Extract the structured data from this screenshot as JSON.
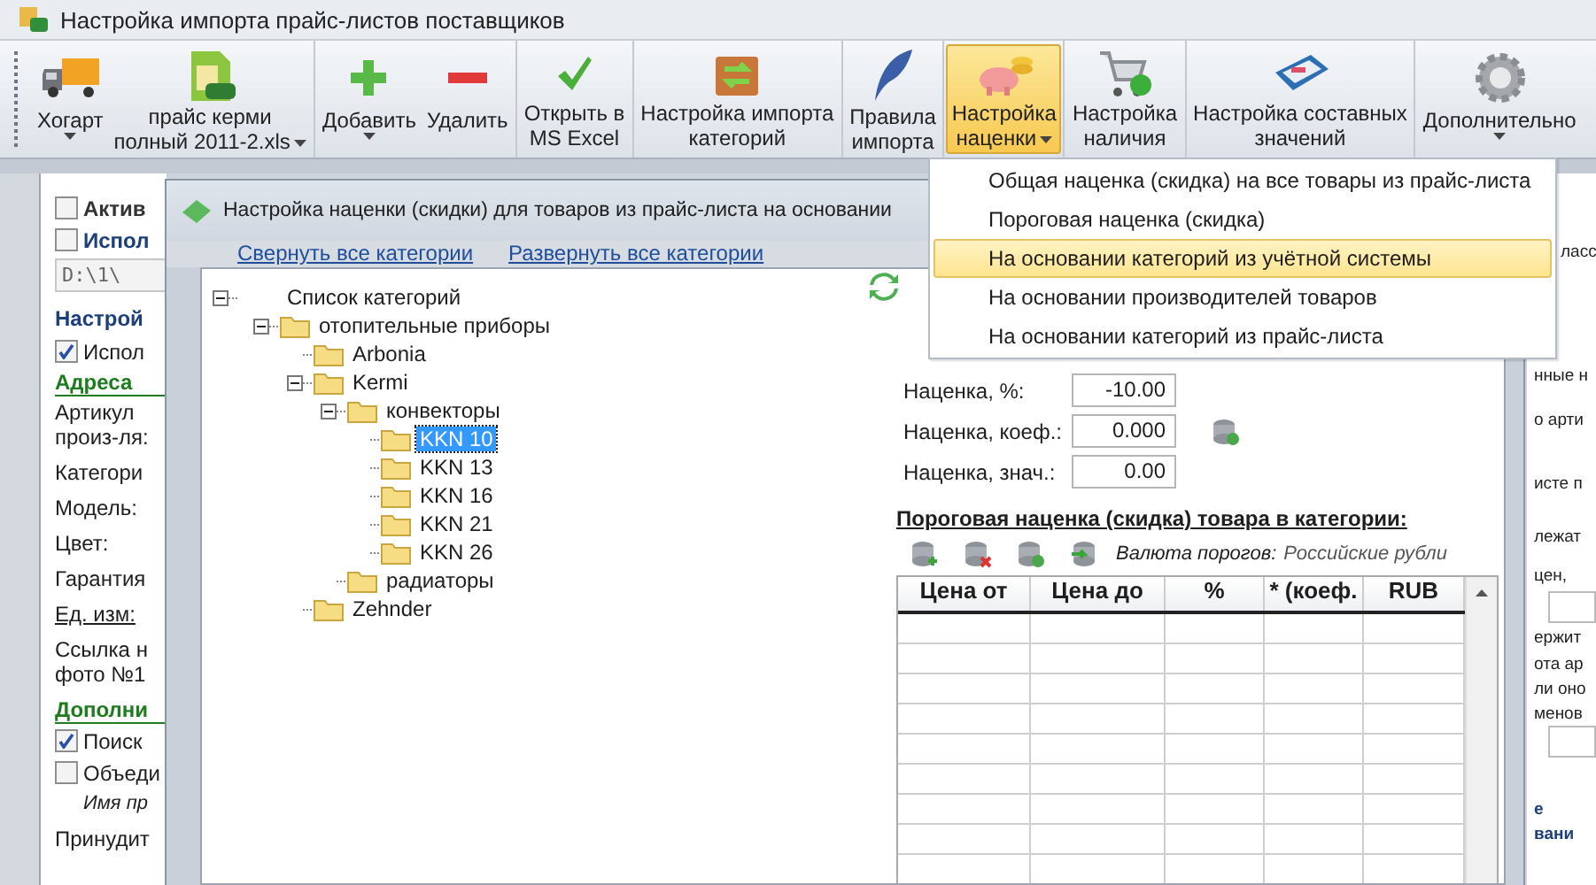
{
  "window": {
    "title": "Настройка импорта прайс-листов поставщиков"
  },
  "toolbar": {
    "groups": [
      [
        {
          "lines": [
            "Хогарт"
          ],
          "dropdown": true,
          "selected": false
        },
        {
          "lines": [
            "прайс керми",
            "полный 2011-2.xls"
          ],
          "dropdown": true,
          "selected": false
        }
      ],
      [
        {
          "lines": [
            "Добавить"
          ],
          "dropdown": true,
          "selected": false
        },
        {
          "lines": [
            "Удалить"
          ],
          "dropdown": false,
          "selected": false
        }
      ],
      [
        {
          "lines": [
            "Открыть в",
            "MS Excel"
          ],
          "dropdown": false,
          "selected": false
        }
      ],
      [
        {
          "lines": [
            "Настройка импорта",
            "категорий"
          ],
          "dropdown": false,
          "selected": false
        }
      ],
      [
        {
          "lines": [
            "Правила",
            "импорта"
          ],
          "dropdown": false,
          "selected": false
        }
      ],
      [
        {
          "lines": [
            "Настройка",
            "наценки"
          ],
          "dropdown": true,
          "selected": true
        }
      ],
      [
        {
          "lines": [
            "Настройка",
            "наличия"
          ],
          "dropdown": false,
          "selected": false
        }
      ],
      [
        {
          "lines": [
            "Настройка составных",
            "значений"
          ],
          "dropdown": false,
          "selected": false
        }
      ],
      [
        {
          "lines": [
            "Дополнительно"
          ],
          "dropdown": true,
          "selected": false
        }
      ]
    ]
  },
  "left_panel": [
    {
      "kind": "checkbox",
      "label": "Актив",
      "checked": false
    },
    {
      "kind": "checkbox-title",
      "label": "Испол",
      "checked": false
    },
    {
      "kind": "path-field",
      "value": "D:\\1\\"
    },
    {
      "kind": "group-title",
      "lines": [
        "Настрой"
      ]
    },
    {
      "kind": "checkbox",
      "label": "Испол",
      "checked": true
    },
    {
      "kind": "section",
      "lines": [
        "Адреса"
      ]
    },
    {
      "kind": "label",
      "lines": [
        "Артикул",
        "произ-ля:"
      ]
    },
    {
      "kind": "label",
      "lines": [
        "Категори"
      ]
    },
    {
      "kind": "label",
      "lines": [
        "Модель:"
      ]
    },
    {
      "kind": "label",
      "lines": [
        "Цвет:"
      ]
    },
    {
      "kind": "label",
      "lines": [
        "Гарантия"
      ]
    },
    {
      "kind": "underlined",
      "lines": [
        "Ед. изм:"
      ]
    },
    {
      "kind": "label",
      "lines": [
        "Ссылка н",
        "фото №1"
      ]
    },
    {
      "kind": "section",
      "lines": [
        "Дополни"
      ]
    },
    {
      "kind": "checkbox",
      "label": "Поиск",
      "checked": true
    },
    {
      "kind": "checkbox",
      "label": "Объеди",
      "checked": false
    },
    {
      "kind": "note",
      "lines": [
        "Имя пр"
      ]
    },
    {
      "kind": "label",
      "lines": [
        "Принудит"
      ]
    }
  ],
  "right_panel": [
    {
      "kind": "text",
      "text": "ласс"
    },
    {
      "kind": "text",
      "text": "нные н"
    },
    {
      "kind": "text",
      "text": "о арти"
    },
    {
      "kind": "text",
      "text": "исте п"
    },
    {
      "kind": "text",
      "text": "лежат"
    },
    {
      "kind": "text",
      "text": "цен,"
    },
    {
      "kind": "field"
    },
    {
      "kind": "text",
      "text": "ержит"
    },
    {
      "kind": "text",
      "text": "ота ар"
    },
    {
      "kind": "text",
      "text": "ли оно"
    },
    {
      "kind": "text",
      "text": "менов"
    },
    {
      "kind": "field"
    },
    {
      "kind": "heading",
      "text": "е"
    },
    {
      "kind": "heading",
      "text": "вани"
    }
  ],
  "dialog": {
    "title": "Настройка наценки (скидки) для товаров из прайс-листа на основании",
    "links": [
      "Свернуть все категории",
      "Развернуть все категории"
    ],
    "tree": {
      "label": "Список категорий",
      "kind": "root",
      "expanded": true,
      "selected": false,
      "children": [
        {
          "label": "отопительные приборы",
          "kind": "folder",
          "expanded": true,
          "selected": false,
          "children": [
            {
              "label": "Arbonia",
              "kind": "folder",
              "expanded": false,
              "selected": false
            },
            {
              "label": "Kermi",
              "kind": "folder",
              "expanded": true,
              "selected": false,
              "children": [
                {
                  "label": "конвекторы",
                  "kind": "folder",
                  "expanded": true,
                  "selected": false,
                  "children": [
                    {
                      "label": "KKN 10",
                      "kind": "folder",
                      "expanded": false,
                      "selected": true
                    },
                    {
                      "label": "KKN 13",
                      "kind": "folder",
                      "expanded": false,
                      "selected": false
                    },
                    {
                      "label": "KKN 16",
                      "kind": "folder",
                      "expanded": false,
                      "selected": false
                    },
                    {
                      "label": "KKN 21",
                      "kind": "folder",
                      "expanded": false,
                      "selected": false
                    },
                    {
                      "label": "KKN 26",
                      "kind": "folder",
                      "expanded": false,
                      "selected": false
                    }
                  ]
                },
                {
                  "label": "радиаторы",
                  "kind": "folder",
                  "expanded": false,
                  "selected": false
                }
              ]
            },
            {
              "label": "Zehnder",
              "kind": "folder",
              "expanded": false,
              "selected": false
            }
          ]
        }
      ]
    },
    "markup_fields": [
      {
        "label": "Наценка, %:",
        "value": "-10.00"
      },
      {
        "label": "Наценка, коеф.:",
        "value": "0.000"
      },
      {
        "label": "Наценка, знач.:",
        "value": "0.00"
      }
    ],
    "threshold": {
      "heading": "Пороговая наценка (скидка) товара в категории:",
      "currency_label": "Валюта порогов:",
      "currency": "Российские рубли",
      "columns": [
        "Цена от",
        "Цена до",
        "%",
        "* (коеф.",
        "RUB"
      ]
    }
  },
  "menu": {
    "items": [
      {
        "label": "Общая наценка (скидка) на все товары из прайс-листа",
        "selected": false
      },
      {
        "label": "Пороговая наценка (скидка)",
        "selected": false
      },
      {
        "label": "На основании категорий из учётной системы",
        "selected": true
      },
      {
        "label": "На основании производителей товаров",
        "selected": false
      },
      {
        "label": "На основании категорий из прайс-листа",
        "selected": false
      }
    ]
  }
}
